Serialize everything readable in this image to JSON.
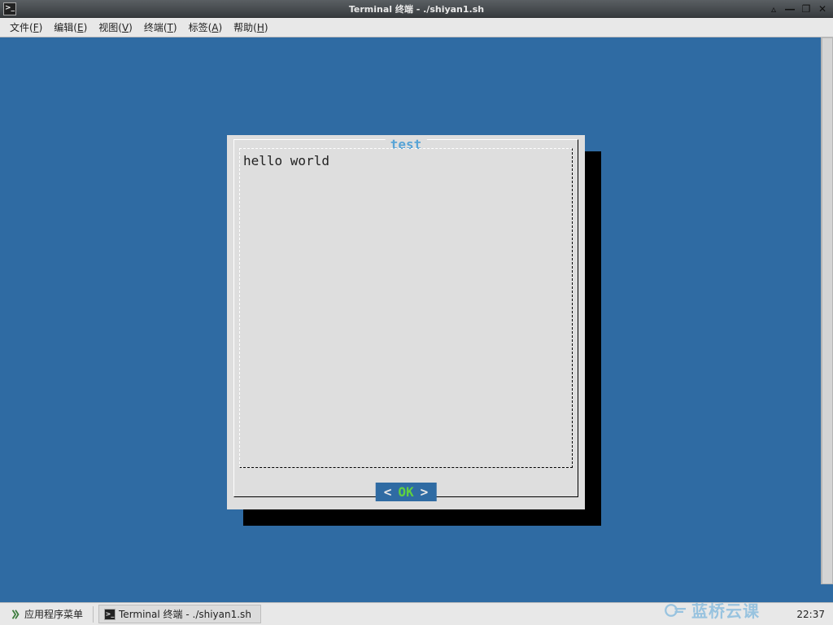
{
  "window": {
    "title": "Terminal 终端 - ./shiyan1.sh"
  },
  "menu": {
    "file": "文件(F)",
    "edit": "编辑(E)",
    "view": "视图(V)",
    "terminal": "终端(T)",
    "tabs": "标签(A)",
    "help": "帮助(H)"
  },
  "dialog": {
    "title": "test",
    "message": "hello world",
    "ok_left": "<",
    "ok_label": "OK",
    "ok_right": ">"
  },
  "taskbar": {
    "app_menu": "应用程序菜单",
    "task_label": "Terminal 终端 - ./shiyan1.sh",
    "clock": "22:37"
  },
  "watermark": "蓝桥云课"
}
